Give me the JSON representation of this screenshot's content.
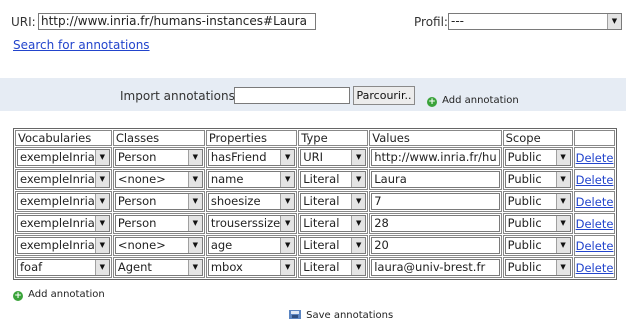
{
  "uri": {
    "label": "URI:",
    "value": "http://www.inria.fr/humans-instances#Laura"
  },
  "profil": {
    "label": "Profil:",
    "selected": "---"
  },
  "search_link": "Search for annotations",
  "import": {
    "label": "Import annotations:",
    "value": "",
    "browse_button": "Parcourir..",
    "add_label": "Add annotation"
  },
  "table": {
    "headers": [
      "Vocabularies",
      "Classes",
      "Properties",
      "Type",
      "Values",
      "Scope",
      ""
    ],
    "rows": [
      {
        "vocab": "exempleInria",
        "class": "Person",
        "property": "hasFriend",
        "type": "URI",
        "value": "http://www.inria.fr/hu",
        "scope": "Public",
        "delete": "Delete"
      },
      {
        "vocab": "exempleInria",
        "class": "<none>",
        "property": "name",
        "type": "Literal",
        "value": "Laura",
        "scope": "Public",
        "delete": "Delete"
      },
      {
        "vocab": "exempleInria",
        "class": "Person",
        "property": "shoesize",
        "type": "Literal",
        "value": "7",
        "scope": "Public",
        "delete": "Delete"
      },
      {
        "vocab": "exempleInria",
        "class": "Person",
        "property": "trouserssize",
        "type": "Literal",
        "value": "28",
        "scope": "Public",
        "delete": "Delete"
      },
      {
        "vocab": "exempleInria",
        "class": "<none>",
        "property": "age",
        "type": "Literal",
        "value": "20",
        "scope": "Public",
        "delete": "Delete"
      },
      {
        "vocab": "foaf",
        "class": "Agent",
        "property": "mbox",
        "type": "Literal",
        "value": "laura@univ-brest.fr",
        "scope": "Public",
        "delete": "Delete"
      }
    ]
  },
  "add_annotation": "Add annotation",
  "save_annotations": "Save annotations",
  "colors": {
    "band": "#e6ecf4",
    "link": "#2244cc",
    "add_icon": "#3aa33a"
  }
}
